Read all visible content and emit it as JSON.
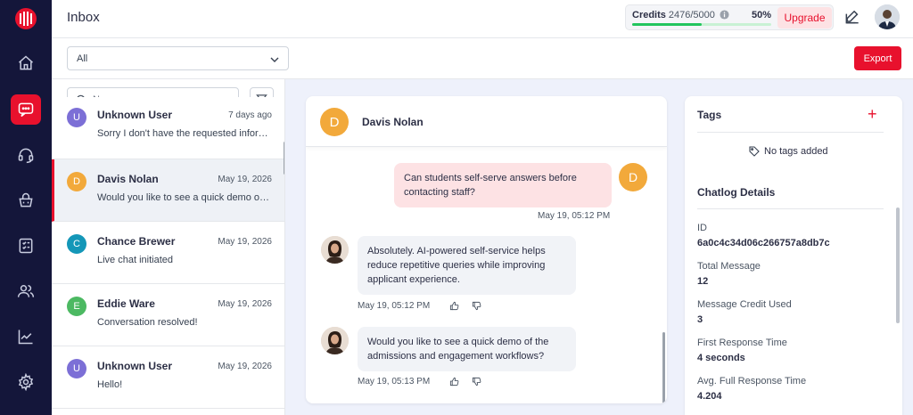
{
  "topbar": {
    "title": "Inbox",
    "credits_label": "Credits",
    "credits_count": "2476/5000",
    "credits_percent": "50%",
    "credits_fraction": 0.5,
    "upgrade_label": "Upgrade"
  },
  "filter": {
    "selected": "All",
    "export_label": "Export"
  },
  "search": {
    "placeholder": "Name"
  },
  "conversations": [
    {
      "initial": "U",
      "name": "Unknown User",
      "date": "7 days ago",
      "preview": "Sorry I don't have the requested information.",
      "color": "#7c6fd6"
    },
    {
      "initial": "D",
      "name": "Davis Nolan",
      "date": "May 19, 2026",
      "preview": "Would you like to see a quick demo of the admissions",
      "color": "#f2a93b"
    },
    {
      "initial": "C",
      "name": "Chance Brewer",
      "date": "May 19, 2026",
      "preview": "Live chat initiated",
      "color": "#1497b8"
    },
    {
      "initial": "E",
      "name": "Eddie Ware",
      "date": "May 19, 2026",
      "preview": "Conversation resolved!",
      "color": "#4cb962"
    },
    {
      "initial": "U",
      "name": "Unknown User",
      "date": "May 19, 2026",
      "preview": "Hello!",
      "color": "#7c6fd6"
    }
  ],
  "chat": {
    "contact_initial": "D",
    "contact_name": "Davis Nolan",
    "messages": [
      {
        "from": "user",
        "text": "Can students self-serve answers before contacting staff?",
        "time": "May 19, 05:12 PM"
      },
      {
        "from": "bot",
        "text": "Absolutely. AI-powered self-service helps reduce repetitive queries while improving applicant experience.",
        "time": "May 19, 05:12 PM"
      },
      {
        "from": "bot",
        "text": "Would you like to see a quick demo of the admissions and engagement workflows?",
        "time": "May 19, 05:13 PM"
      }
    ]
  },
  "details": {
    "tags_heading": "Tags",
    "add_symbol": "+",
    "no_tags": "No tags added",
    "chatlog_heading": "Chatlog Details",
    "fields": [
      {
        "label": "ID",
        "value": "6a0c4c34d06c266757a8db7c"
      },
      {
        "label": "Total Message",
        "value": "12"
      },
      {
        "label": "Message Credit Used",
        "value": "3"
      },
      {
        "label": "First Response Time",
        "value": "4 seconds"
      },
      {
        "label": "Avg. Full Response Time",
        "value": "4.204"
      }
    ]
  },
  "colors": {
    "sidebar": "#14163a",
    "accent": "#e8112d",
    "progress": "#22c55e"
  },
  "icons": {
    "nav": [
      "home-icon",
      "chat-icon",
      "headset-icon",
      "basket-icon",
      "checklist-icon",
      "users-icon",
      "analytics-icon",
      "settings-icon"
    ]
  }
}
